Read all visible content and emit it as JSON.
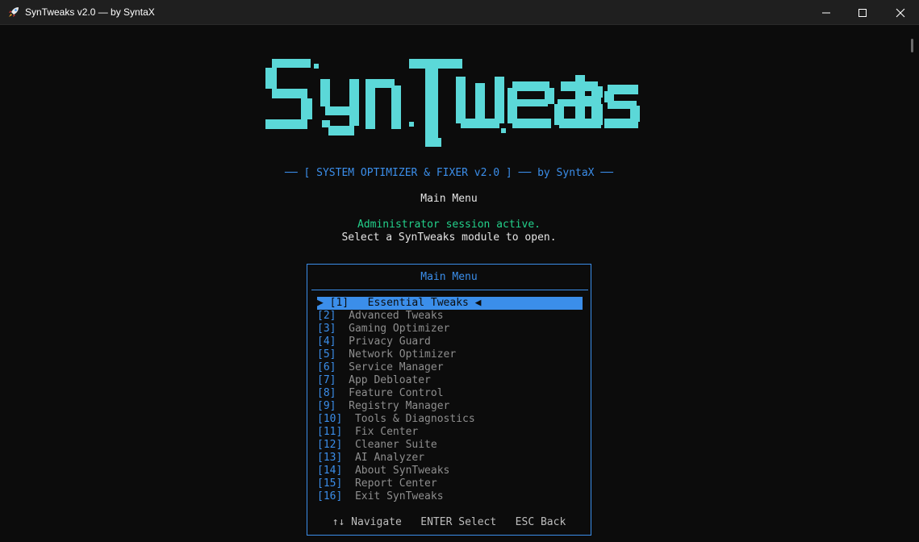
{
  "window": {
    "title": "SynTweaks v2.0 — by SyntaX"
  },
  "header": {
    "logo_text": "SynTweaks",
    "subtitle": "── [ SYSTEM OPTIMIZER & FIXER v2.0 ] ── by SyntaX ──",
    "menu_heading": "Main Menu",
    "admin_status": "Administrator session active.",
    "instruction": "Select a SynTweaks module to open."
  },
  "menu": {
    "title": "Main Menu",
    "selected_index": 0,
    "items": [
      {
        "num": "[1]",
        "label": "Essential Tweaks"
      },
      {
        "num": "[2]",
        "label": "Advanced Tweaks"
      },
      {
        "num": "[3]",
        "label": "Gaming Optimizer"
      },
      {
        "num": "[4]",
        "label": "Privacy Guard"
      },
      {
        "num": "[5]",
        "label": "Network Optimizer"
      },
      {
        "num": "[6]",
        "label": "Service Manager"
      },
      {
        "num": "[7]",
        "label": "App Debloater"
      },
      {
        "num": "[8]",
        "label": "Feature Control"
      },
      {
        "num": "[9]",
        "label": "Registry Manager"
      },
      {
        "num": "[10]",
        "label": "Tools & Diagnostics"
      },
      {
        "num": "[11]",
        "label": "Fix Center"
      },
      {
        "num": "[12]",
        "label": "Cleaner Suite"
      },
      {
        "num": "[13]",
        "label": "AI Analyzer"
      },
      {
        "num": "[14]",
        "label": "About SynTweaks"
      },
      {
        "num": "[15]",
        "label": "Report Center"
      },
      {
        "num": "[16]",
        "label": "Exit SynTweaks"
      }
    ],
    "footer": "↑↓ Navigate   ENTER Select   ESC Back"
  },
  "colors": {
    "logo": "#5bd8d8",
    "accent": "#3b8eea",
    "admin": "#23d18b",
    "background": "#0c0c0c"
  }
}
